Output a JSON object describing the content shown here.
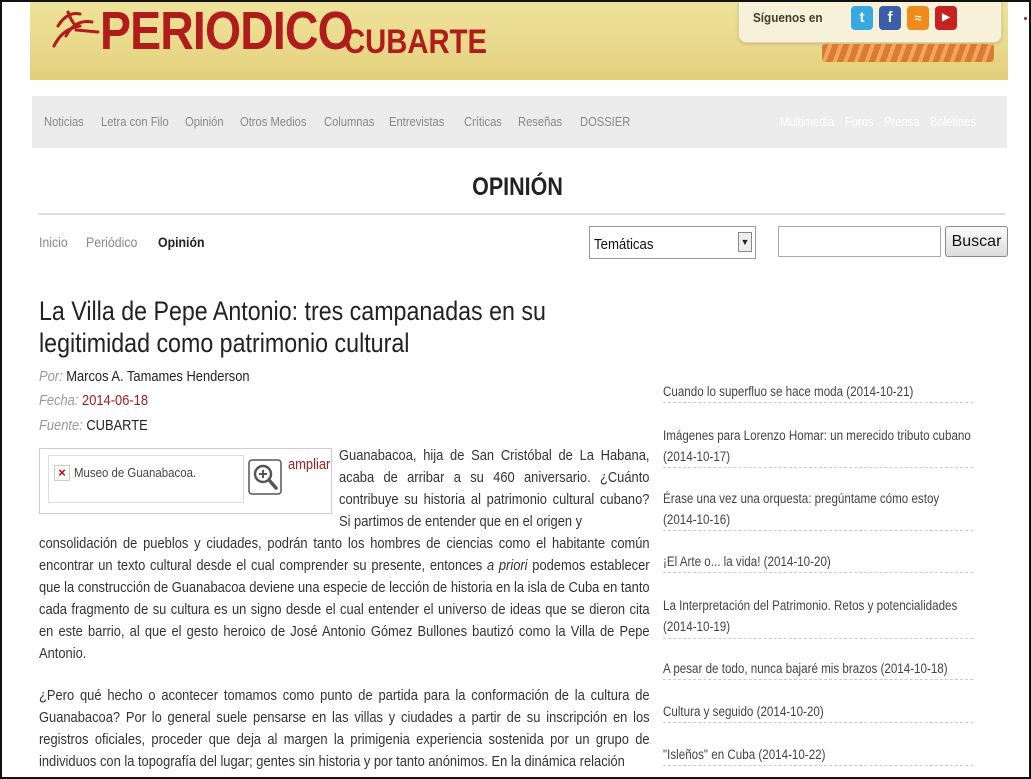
{
  "header": {
    "logo_main": "PERIODICO",
    "logo_sub": "CUBARTE",
    "follow_label": "Síguenos en",
    "social": [
      {
        "name": "twitter-icon",
        "glyph": "t",
        "color": "#37a8e0"
      },
      {
        "name": "facebook-icon",
        "glyph": "f",
        "color": "#3b5ea8"
      },
      {
        "name": "rss-icon",
        "glyph": "≈",
        "color": "#f08a1c"
      },
      {
        "name": "youtube-icon",
        "glyph": "▶",
        "color": "#c62222"
      }
    ]
  },
  "nav": {
    "left": [
      "Noticias",
      "Letra con Filo",
      "Opinión",
      "Otros Medios",
      "Columnas",
      "Entrevistas",
      "Críticas",
      "Reseñas",
      "DOSSIER"
    ],
    "right": [
      "Multimedia",
      "Foros",
      "Prensa",
      "Boletines"
    ]
  },
  "section_title": "OPINIÓN",
  "breadcrumb": [
    "Inicio",
    "Periódico",
    "Opinión"
  ],
  "filters": {
    "tematicas_selected": "Temáticas",
    "search_value": "",
    "search_button": "Buscar"
  },
  "article": {
    "title": "La Villa de Pepe Antonio: tres campanadas en su legitimidad como patrimonio cultural",
    "por_label": "Por:",
    "author": "Marcos A. Tamames Henderson",
    "fecha_label": "Fecha:",
    "date": "2014-06-18",
    "fuente_label": "Fuente:",
    "source": "CUBARTE",
    "image_alt": "Museo de Guanabacoa.",
    "ampliar": "ampliar",
    "p1_wrap": "Guanabacoa, hija de San Cristóbal de La Habana, acaba de arribar a su 460 aniversario. ¿Cuánto contribuye su historia al patrimonio cultural cubano? Si partimos de entender que en el origen y",
    "p1_full_a": "consolidación de pueblos y ciudades, podrán tanto los hombres de ciencias como el habitante común encontrar un texto cultural desde el cual comprender su presente, entonces ",
    "p1_italic": "a priori",
    "p1_full_b": " podemos establecer que la construcción de Guanabacoa deviene una especie de lección de historia en la isla de Cuba en tanto cada fragmento de su cultura es un signo desde el cual entender el universo de ideas que se dieron cita en este barrio, al que el gesto heroico de José Antonio Gómez Bullones bautizó como la Villa de Pepe Antonio.",
    "p2": "¿Pero qué hecho o acontecer tomamos como punto de partida para la conformación de la cultura de Guanabacoa? Por lo general suele pensarse en las villas y ciudades a partir de su inscripción en los registros oficiales, proceder que deja al margen la primigenia  experiencia sostenida por un grupo de individuos con la topografía del lugar; gentes sin historia y por tanto anónimos. En la dinámica relación"
  },
  "sidebar": [
    "Cuando lo superfluo se hace moda (2014-10-21)",
    "Imágenes para Lorenzo Homar: un merecido tributo cubano (2014-10-17)",
    "Érase una vez una orquesta: pregúntame cómo estoy (2014-10-16)",
    "¡El Arte o... la vida! (2014-10-20)",
    "La Interpretación del Patrimonio. Retos y potencialidades (2014-10-19)",
    "A pesar de todo, nunca bajaré mis brazos (2014-10-18)",
    "Cultura y seguido (2014-10-20)",
    "\"Isleños\" en Cuba (2014-10-22)"
  ]
}
